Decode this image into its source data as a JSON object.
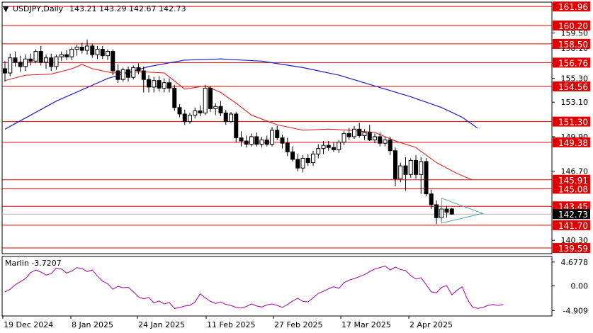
{
  "header": {
    "symbol_label": "USDJPY,Daily",
    "ohlc": "143.21 143.29 142.67 142.73",
    "menu_icon": "triangle-down-icon"
  },
  "colors": {
    "background": "#ffffff",
    "axis": "#000000",
    "grid_level": "#e00000",
    "level_label_bg": "#e00000",
    "ma_slow": "#1a1acc",
    "ma_fast": "#e01010",
    "oscillator": "#a000a0",
    "triangle": "#4aa5a5",
    "current_price_bg": "#000000"
  },
  "chart_data": [
    {
      "type": "candlestick",
      "title": "USDJPY,Daily",
      "x_tick_labels": [
        "19 Dec 2024",
        "8 Jan 2025",
        "24 Jan 2025",
        "11 Feb 2025",
        "27 Feb 2025",
        "17 Mar 2025",
        "2 Apr 2025"
      ],
      "price_axis_labels": [
        "159.50",
        "158.10",
        "156.70",
        "155.30",
        "153.10",
        "149.90",
        "146.70",
        "140.30"
      ],
      "ylim": [
        139.2,
        162.3
      ],
      "horizontal_levels": [
        161.96,
        160.2,
        158.5,
        156.76,
        154.56,
        151.3,
        149.38,
        145.91,
        145.08,
        143.45,
        141.7,
        139.59
      ],
      "current_price": 142.73,
      "candles": [
        {
          "o": 156.2,
          "h": 156.9,
          "l": 155.0,
          "c": 155.8
        },
        {
          "o": 155.8,
          "h": 157.6,
          "l": 155.5,
          "c": 157.2
        },
        {
          "o": 157.2,
          "h": 157.8,
          "l": 156.4,
          "c": 156.8
        },
        {
          "o": 156.8,
          "h": 157.4,
          "l": 155.9,
          "c": 156.4
        },
        {
          "o": 156.4,
          "h": 157.5,
          "l": 156.0,
          "c": 157.1
        },
        {
          "o": 157.1,
          "h": 157.6,
          "l": 156.5,
          "c": 156.9
        },
        {
          "o": 156.9,
          "h": 158.0,
          "l": 156.7,
          "c": 157.8
        },
        {
          "o": 157.8,
          "h": 158.3,
          "l": 156.5,
          "c": 156.8
        },
        {
          "o": 156.8,
          "h": 157.5,
          "l": 156.2,
          "c": 157.2
        },
        {
          "o": 157.2,
          "h": 157.6,
          "l": 156.0,
          "c": 156.4
        },
        {
          "o": 156.4,
          "h": 157.5,
          "l": 156.1,
          "c": 157.3
        },
        {
          "o": 157.3,
          "h": 157.8,
          "l": 156.9,
          "c": 157.5
        },
        {
          "o": 157.5,
          "h": 157.9,
          "l": 157.0,
          "c": 157.3
        },
        {
          "o": 157.3,
          "h": 158.2,
          "l": 157.0,
          "c": 158.0
        },
        {
          "o": 158.0,
          "h": 158.4,
          "l": 157.4,
          "c": 158.2
        },
        {
          "o": 158.2,
          "h": 158.6,
          "l": 157.6,
          "c": 157.9
        },
        {
          "o": 157.9,
          "h": 158.9,
          "l": 157.5,
          "c": 158.3
        },
        {
          "o": 158.3,
          "h": 158.5,
          "l": 157.2,
          "c": 157.5
        },
        {
          "o": 157.5,
          "h": 158.3,
          "l": 157.1,
          "c": 158.0
        },
        {
          "o": 158.0,
          "h": 158.3,
          "l": 157.1,
          "c": 157.4
        },
        {
          "o": 157.4,
          "h": 158.0,
          "l": 157.0,
          "c": 157.8
        },
        {
          "o": 157.8,
          "h": 158.0,
          "l": 155.6,
          "c": 156.0
        },
        {
          "o": 156.0,
          "h": 156.6,
          "l": 154.9,
          "c": 155.2
        },
        {
          "o": 155.2,
          "h": 156.3,
          "l": 155.0,
          "c": 156.1
        },
        {
          "o": 156.1,
          "h": 156.4,
          "l": 155.0,
          "c": 155.4
        },
        {
          "o": 155.4,
          "h": 156.5,
          "l": 155.2,
          "c": 156.3
        },
        {
          "o": 156.3,
          "h": 156.7,
          "l": 155.7,
          "c": 156.0
        },
        {
          "o": 156.0,
          "h": 156.4,
          "l": 154.0,
          "c": 155.2
        },
        {
          "o": 155.2,
          "h": 155.6,
          "l": 154.0,
          "c": 154.5
        },
        {
          "o": 154.5,
          "h": 155.4,
          "l": 154.0,
          "c": 155.1
        },
        {
          "o": 155.1,
          "h": 155.5,
          "l": 154.1,
          "c": 154.4
        },
        {
          "o": 154.4,
          "h": 155.3,
          "l": 154.0,
          "c": 154.9
        },
        {
          "o": 154.9,
          "h": 155.3,
          "l": 154.0,
          "c": 154.4
        },
        {
          "o": 154.4,
          "h": 154.7,
          "l": 152.3,
          "c": 152.6
        },
        {
          "o": 152.6,
          "h": 152.9,
          "l": 151.7,
          "c": 152.0
        },
        {
          "o": 152.0,
          "h": 152.4,
          "l": 151.0,
          "c": 151.3
        },
        {
          "o": 151.3,
          "h": 152.1,
          "l": 151.1,
          "c": 151.9
        },
        {
          "o": 151.9,
          "h": 152.6,
          "l": 151.6,
          "c": 152.3
        },
        {
          "o": 152.3,
          "h": 152.8,
          "l": 151.8,
          "c": 152.1
        },
        {
          "o": 152.1,
          "h": 154.7,
          "l": 151.9,
          "c": 154.4
        },
        {
          "o": 154.4,
          "h": 154.6,
          "l": 152.2,
          "c": 152.5
        },
        {
          "o": 152.5,
          "h": 153.0,
          "l": 151.9,
          "c": 152.7
        },
        {
          "o": 152.7,
          "h": 153.2,
          "l": 151.8,
          "c": 152.1
        },
        {
          "o": 152.1,
          "h": 152.4,
          "l": 151.0,
          "c": 151.3
        },
        {
          "o": 151.3,
          "h": 152.2,
          "l": 151.2,
          "c": 152.0
        },
        {
          "o": 152.0,
          "h": 152.2,
          "l": 149.4,
          "c": 149.8
        },
        {
          "o": 149.8,
          "h": 150.4,
          "l": 149.0,
          "c": 149.5
        },
        {
          "o": 149.5,
          "h": 150.0,
          "l": 148.9,
          "c": 149.2
        },
        {
          "o": 149.2,
          "h": 150.2,
          "l": 149.0,
          "c": 149.9
        },
        {
          "o": 149.9,
          "h": 150.3,
          "l": 149.0,
          "c": 149.2
        },
        {
          "o": 149.2,
          "h": 149.9,
          "l": 148.9,
          "c": 149.6
        },
        {
          "o": 149.6,
          "h": 150.0,
          "l": 149.0,
          "c": 149.2
        },
        {
          "o": 149.2,
          "h": 150.8,
          "l": 149.0,
          "c": 150.5
        },
        {
          "o": 150.5,
          "h": 150.9,
          "l": 149.6,
          "c": 149.8
        },
        {
          "o": 149.8,
          "h": 150.1,
          "l": 148.8,
          "c": 149.3
        },
        {
          "o": 149.3,
          "h": 149.8,
          "l": 148.1,
          "c": 148.5
        },
        {
          "o": 148.5,
          "h": 149.0,
          "l": 147.6,
          "c": 147.8
        },
        {
          "o": 147.8,
          "h": 148.3,
          "l": 146.7,
          "c": 147.0
        },
        {
          "o": 147.0,
          "h": 148.2,
          "l": 146.6,
          "c": 147.9
        },
        {
          "o": 147.9,
          "h": 148.3,
          "l": 147.2,
          "c": 147.5
        },
        {
          "o": 147.5,
          "h": 148.6,
          "l": 147.2,
          "c": 148.3
        },
        {
          "o": 148.3,
          "h": 149.2,
          "l": 147.9,
          "c": 148.8
        },
        {
          "o": 148.8,
          "h": 149.5,
          "l": 148.3,
          "c": 149.1
        },
        {
          "o": 149.1,
          "h": 149.5,
          "l": 148.6,
          "c": 148.9
        },
        {
          "o": 148.9,
          "h": 149.4,
          "l": 148.5,
          "c": 148.7
        },
        {
          "o": 148.7,
          "h": 149.6,
          "l": 148.4,
          "c": 149.4
        },
        {
          "o": 149.4,
          "h": 150.4,
          "l": 149.1,
          "c": 150.2
        },
        {
          "o": 150.2,
          "h": 150.7,
          "l": 149.6,
          "c": 149.9
        },
        {
          "o": 149.9,
          "h": 150.9,
          "l": 149.7,
          "c": 150.6
        },
        {
          "o": 150.6,
          "h": 151.2,
          "l": 149.8,
          "c": 150.0
        },
        {
          "o": 150.0,
          "h": 150.6,
          "l": 149.6,
          "c": 150.3
        },
        {
          "o": 150.3,
          "h": 151.0,
          "l": 149.5,
          "c": 149.6
        },
        {
          "o": 149.6,
          "h": 150.2,
          "l": 149.3,
          "c": 149.9
        },
        {
          "o": 149.9,
          "h": 150.3,
          "l": 149.0,
          "c": 149.3
        },
        {
          "o": 149.3,
          "h": 149.9,
          "l": 149.0,
          "c": 149.6
        },
        {
          "o": 149.6,
          "h": 149.9,
          "l": 148.2,
          "c": 148.6
        },
        {
          "o": 148.6,
          "h": 148.9,
          "l": 145.3,
          "c": 146.0
        },
        {
          "o": 146.0,
          "h": 147.5,
          "l": 145.7,
          "c": 147.2
        },
        {
          "o": 147.2,
          "h": 148.0,
          "l": 144.9,
          "c": 146.4
        },
        {
          "o": 146.4,
          "h": 147.9,
          "l": 146.1,
          "c": 147.7
        },
        {
          "o": 147.7,
          "h": 148.2,
          "l": 146.0,
          "c": 146.4
        },
        {
          "o": 146.4,
          "h": 148.0,
          "l": 144.6,
          "c": 147.6
        },
        {
          "o": 147.6,
          "h": 147.9,
          "l": 144.4,
          "c": 144.6
        },
        {
          "o": 144.6,
          "h": 145.0,
          "l": 143.2,
          "c": 143.6
        },
        {
          "o": 143.6,
          "h": 144.0,
          "l": 141.8,
          "c": 142.4
        },
        {
          "o": 142.4,
          "h": 143.5,
          "l": 142.1,
          "c": 143.2
        },
        {
          "o": 143.2,
          "h": 143.5,
          "l": 142.4,
          "c": 142.9
        },
        {
          "o": 143.21,
          "h": 143.29,
          "l": 142.67,
          "c": 142.73
        }
      ],
      "ma_slow": [
        [
          0,
          150.6
        ],
        [
          10,
          153.2
        ],
        [
          20,
          155.3
        ],
        [
          28,
          156.4
        ],
        [
          35,
          157.0
        ],
        [
          42,
          157.1
        ],
        [
          50,
          156.9
        ],
        [
          58,
          156.3
        ],
        [
          65,
          155.6
        ],
        [
          72,
          154.6
        ],
        [
          79,
          153.6
        ],
        [
          85,
          152.6
        ],
        [
          89,
          151.7
        ],
        [
          92,
          150.7
        ]
      ],
      "ma_fast": [
        [
          0,
          155.1
        ],
        [
          4,
          155.6
        ],
        [
          9,
          155.7
        ],
        [
          13,
          156.2
        ],
        [
          15,
          156.6
        ],
        [
          17,
          156.2
        ],
        [
          21,
          155.8
        ],
        [
          27,
          155.9
        ],
        [
          31,
          155.8
        ],
        [
          35,
          154.3
        ],
        [
          39,
          154.6
        ],
        [
          42,
          154.0
        ],
        [
          45,
          153.0
        ],
        [
          48,
          151.9
        ],
        [
          53,
          151.0
        ],
        [
          58,
          150.5
        ],
        [
          63,
          150.6
        ],
        [
          67,
          150.5
        ],
        [
          72,
          150.3
        ],
        [
          76,
          149.5
        ],
        [
          80,
          148.9
        ],
        [
          84,
          147.5
        ],
        [
          88,
          146.5
        ],
        [
          91,
          145.9
        ]
      ],
      "triangle_pattern": [
        [
          85,
          144.2
        ],
        [
          93,
          142.8
        ],
        [
          85,
          141.9
        ]
      ]
    },
    {
      "type": "line",
      "indicator_label": "Marlin -3.7207",
      "y_tick_labels": [
        "4.6778",
        "0.00",
        "-4.909"
      ],
      "ylim": [
        -5.7,
        5.5
      ],
      "values": [
        -1.2,
        -0.7,
        0.2,
        0.8,
        1.4,
        2.6,
        3.1,
        2.7,
        2.1,
        2.4,
        3.5,
        3.3,
        2.5,
        2.9,
        3.6,
        3.4,
        2.8,
        3.1,
        1.9,
        0.9,
        0.4,
        -0.7,
        -0.1,
        -0.4,
        -0.3,
        -1.2,
        -2.2,
        -2.6,
        -2.3,
        -3.4,
        -3.0,
        -3.6,
        -3.3,
        -4.5,
        -4.3,
        -4.0,
        -3.9,
        -3.2,
        -1.6,
        -2.4,
        -3.1,
        -3.5,
        -3.2,
        -3.7,
        -3.9,
        -4.3,
        -4.4,
        -4.1,
        -3.6,
        -4.0,
        -4.2,
        -3.8,
        -3.6,
        -3.9,
        -4.3,
        -3.7,
        -3.0,
        -2.5,
        -3.1,
        -3.2,
        -2.4,
        -1.5,
        -1.1,
        -0.6,
        -0.2,
        -0.5,
        0.6,
        1.1,
        1.4,
        1.8,
        2.2,
        2.8,
        3.3,
        3.6,
        3.9,
        3.1,
        3.7,
        3.2,
        3.0,
        2.0,
        1.3,
        1.6,
        0.2,
        -1.2,
        -1.4,
        -0.3,
        0.0,
        -1.8,
        -0.9,
        -0.2,
        -2.6,
        -4.2,
        -4.5,
        -4.3,
        -3.9,
        -3.7,
        -3.9,
        -3.72
      ]
    }
  ]
}
